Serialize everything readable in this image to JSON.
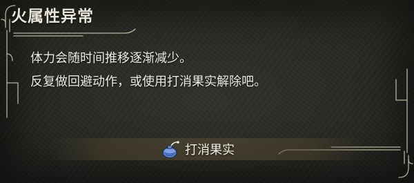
{
  "status": {
    "title": "火属性异常",
    "description_lines": [
      "体力会随时间推移逐渐减少。",
      "反复做回避动作，或使用打消果实解除吧。"
    ]
  },
  "remedy": {
    "icon": "nulberry-icon",
    "label": "打消果实"
  },
  "colors": {
    "frame": "#b9b29b",
    "text": "#ecebe4",
    "item_icon_blue": "#5b86d8",
    "item_bar": "#544932"
  }
}
